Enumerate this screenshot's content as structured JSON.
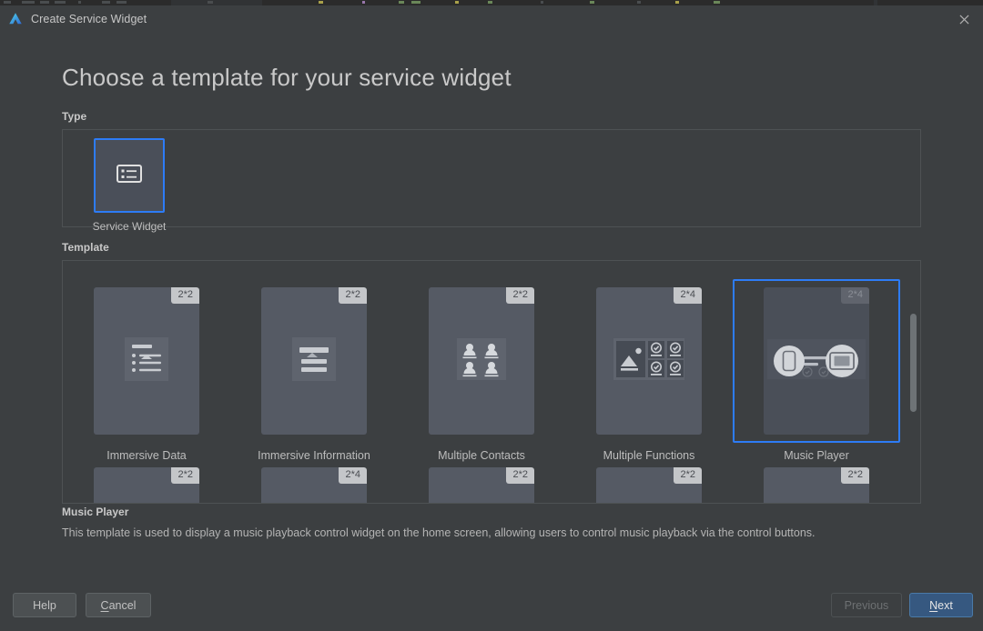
{
  "window": {
    "title": "Create Service Widget",
    "logo_icon": "deveco-logo-icon",
    "close_icon": "close-icon"
  },
  "heading": "Choose a template for your service widget",
  "sections": {
    "type_label": "Type",
    "template_label": "Template"
  },
  "type": {
    "items": [
      {
        "label": "Service Widget",
        "icon": "service-widget-list-icon",
        "selected": true
      }
    ]
  },
  "templates": {
    "row1": [
      {
        "name": "Immersive Data",
        "size": "2*2",
        "art": "list-lines",
        "selected": false
      },
      {
        "name": "Immersive Information",
        "size": "2*2",
        "art": "text-block",
        "selected": false
      },
      {
        "name": "Multiple Contacts",
        "size": "2*2",
        "art": "contacts-grid",
        "selected": false
      },
      {
        "name": "Multiple Functions",
        "size": "2*4",
        "art": "functions-grid",
        "selected": false
      },
      {
        "name": "Music Player",
        "size": "2*4",
        "art": "music-devices",
        "selected": true
      }
    ],
    "row2": [
      {
        "name": "",
        "size": "2*2",
        "art": "blank",
        "selected": false
      },
      {
        "name": "",
        "size": "2*4",
        "art": "blank",
        "selected": false
      },
      {
        "name": "",
        "size": "2*2",
        "art": "blank",
        "selected": false
      },
      {
        "name": "",
        "size": "2*2",
        "art": "blank",
        "selected": false
      },
      {
        "name": "",
        "size": "2*2",
        "art": "blank",
        "selected": false
      }
    ]
  },
  "description": {
    "title": "Music Player",
    "body": "This template is used to display a music playback control widget on the home screen, allowing users to control music playback via the control buttons."
  },
  "footer": {
    "help": "Help",
    "cancel_pre": "C",
    "cancel_post": "ancel",
    "previous": "Previous",
    "next_pre": "N",
    "next_post": "ext"
  },
  "colors": {
    "accent": "#2d7cf6",
    "primary_button": "#365880",
    "dialog_bg": "#3c3f41",
    "card_fill": "#555a64",
    "badge_bg": "#c4c6c9"
  }
}
